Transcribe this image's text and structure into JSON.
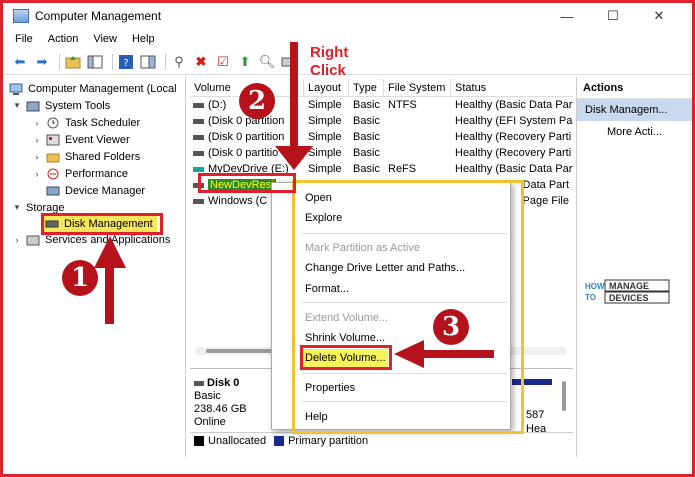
{
  "window": {
    "title": "Computer Management",
    "minimize": "—",
    "maximize": "☐",
    "close": "✕"
  },
  "menu": [
    "File",
    "Action",
    "View",
    "Help"
  ],
  "tree": {
    "root": "Computer Management (Local",
    "system_tools": "System Tools",
    "task_scheduler": "Task Scheduler",
    "event_viewer": "Event Viewer",
    "shared_folders": "Shared Folders",
    "performance": "Performance",
    "device_manager": "Device Manager",
    "storage": "Storage",
    "disk_management": "Disk Management",
    "services": "Services and Applications"
  },
  "list": {
    "headers": [
      "Volume",
      "Layout",
      "Type",
      "File System",
      "Status"
    ],
    "rows": [
      {
        "volume": "(D:)",
        "layout": "Simple",
        "type": "Basic",
        "fs": "NTFS",
        "status": "Healthy (Basic Data Part"
      },
      {
        "volume": "(Disk 0 partition",
        "layout": "Simple",
        "type": "Basic",
        "fs": "",
        "status": "Healthy (EFI System Par"
      },
      {
        "volume": "(Disk 0 partition",
        "layout": "Simple",
        "type": "Basic",
        "fs": "",
        "status": "Healthy (Recovery Parti"
      },
      {
        "volume": "(Disk 0 partitio",
        "layout": "Simple",
        "type": "Basic",
        "fs": "",
        "status": "Healthy (Recovery Parti"
      },
      {
        "volume": "MyDevDrive (E:)",
        "layout": "Simple",
        "type": "Basic",
        "fs": "ReFS",
        "status": "Healthy (Basic Data Part"
      },
      {
        "volume": "NewDevResi",
        "layout": "",
        "type": "",
        "fs": "",
        "status": "Data Part"
      },
      {
        "volume": "Windows (C",
        "layout": "",
        "type": "",
        "fs": "",
        "status": "Page File"
      }
    ]
  },
  "actions": {
    "title": "Actions",
    "section": "Disk Managem...",
    "more": "More Acti..."
  },
  "disk": {
    "name": "Disk 0",
    "type": "Basic",
    "size": "238.46 GB",
    "state": "Online",
    "frag1": "587",
    "frag2": "Hea"
  },
  "legend": {
    "unallocated": "Unallocated",
    "primary": "Primary partition"
  },
  "context_menu": {
    "open": "Open",
    "explore": "Explore",
    "mark_active": "Mark Partition as Active",
    "change_letter": "Change Drive Letter and Paths...",
    "format": "Format...",
    "extend": "Extend Volume...",
    "shrink": "Shrink Volume...",
    "delete": "Delete Volume...",
    "properties": "Properties",
    "help": "Help"
  },
  "annotations": {
    "badge1": "1",
    "badge2": "2",
    "badge3": "3",
    "right_click": "Right Click"
  },
  "logo": {
    "how": "HOW",
    "to": "TO",
    "manage": "MANAGE",
    "devices": "DEVICES"
  },
  "colors": {
    "annotation_red": "#e0202a",
    "highlight_yellow": "#f5c12e",
    "selection_green": "#2c8a2c"
  }
}
